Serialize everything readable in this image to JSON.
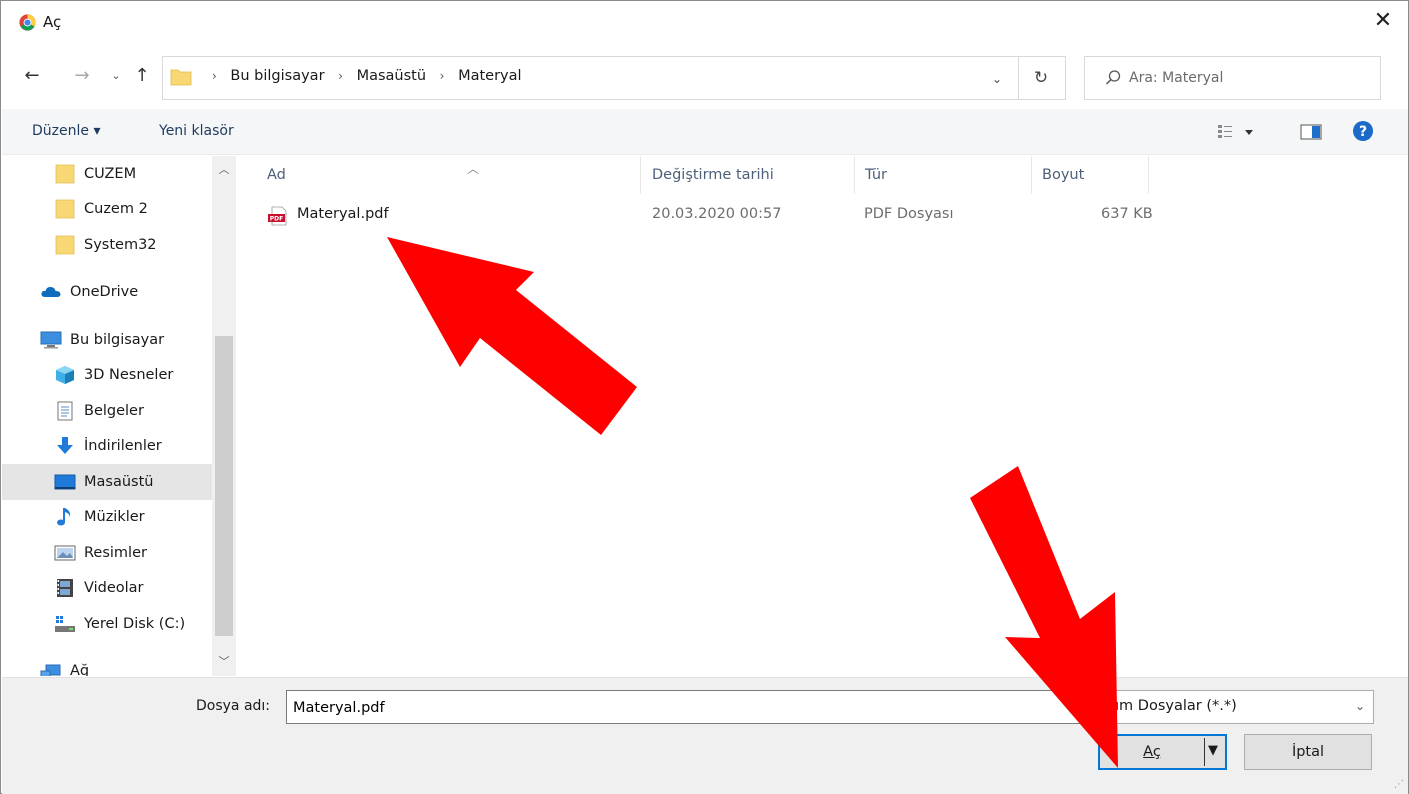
{
  "window": {
    "title": "Aç",
    "close_icon": "close-icon"
  },
  "navigation": {
    "breadcrumbs": [
      "Bu bilgisayar",
      "Masaüstü",
      "Materyal"
    ],
    "search_placeholder": "Ara: Materyal"
  },
  "toolbar": {
    "organize_label": "Düzenle ▾",
    "new_folder_label": "Yeni klasör"
  },
  "sidebar": {
    "items": [
      {
        "label": "CUZEM",
        "icon": "folder-icon"
      },
      {
        "label": "Cuzem 2",
        "icon": "folder-icon"
      },
      {
        "label": "System32",
        "icon": "folder-icon"
      },
      {
        "label": "OneDrive",
        "icon": "cloud-icon"
      },
      {
        "label": "Bu bilgisayar",
        "icon": "computer-icon"
      },
      {
        "label": "3D Nesneler",
        "icon": "cube-icon"
      },
      {
        "label": "Belgeler",
        "icon": "document-icon"
      },
      {
        "label": "İndirilenler",
        "icon": "download-icon"
      },
      {
        "label": "Masaüstü",
        "icon": "desktop-icon",
        "selected": true
      },
      {
        "label": "Müzikler",
        "icon": "music-icon"
      },
      {
        "label": "Resimler",
        "icon": "pictures-icon"
      },
      {
        "label": "Videolar",
        "icon": "video-icon"
      },
      {
        "label": "Yerel Disk (C:)",
        "icon": "drive-icon"
      },
      {
        "label": "Ağ",
        "icon": "network-icon"
      }
    ]
  },
  "file_list": {
    "columns": [
      "Ad",
      "Değiştirme tarihi",
      "Tür",
      "Boyut"
    ],
    "rows": [
      {
        "name": "Materyal.pdf",
        "modified": "20.03.2020 00:57",
        "type": "PDF Dosyası",
        "size": "637 KB",
        "icon": "pdf-icon"
      }
    ]
  },
  "footer": {
    "filename_label": "Dosya adı:",
    "filename_value": "Materyal.pdf",
    "filetype_value": "Tüm Dosyalar (*.*)",
    "open_label": "Aç",
    "cancel_label": "İptal"
  },
  "colors": {
    "accent": "#0078d7",
    "annotation_arrow": "#ff0000"
  }
}
